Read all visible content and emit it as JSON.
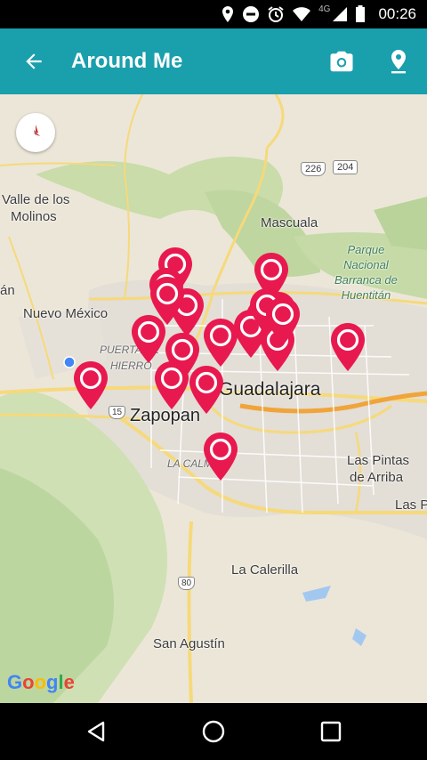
{
  "status_bar": {
    "time": "00:26",
    "network": "4G"
  },
  "app_bar": {
    "title": "Around Me",
    "back_icon": "arrow-back-icon",
    "camera_icon": "camera-icon",
    "location_icon": "place-icon"
  },
  "map": {
    "labels": {
      "valle": "Valle de los",
      "molinos": "Molinos",
      "mascuala": "Mascuala",
      "parque1": "Parque",
      "parque2": "Nacional",
      "parque3": "Barranca de",
      "parque4": "Huentitán",
      "nuevo_mexico": "Nuevo México",
      "puerta1": "PUERTA DE",
      "puerta2": "HIERRO",
      "guadalajara": "Guadalajara",
      "zapopan": "Zapopan",
      "la_calma": "LA CALMA",
      "las_pintas1": "Las Pintas",
      "las_pintas2": "de Arriba",
      "las_p": "Las P",
      "la_calerilla": "La Calerilla",
      "san_agustin": "San Agustín",
      "an": "án",
      "hw226": "226",
      "hw204": "204",
      "hw15": "15",
      "hw80": "80"
    },
    "marker_count": 20,
    "marker_color": "#e8194f",
    "attribution": "Google"
  },
  "colors": {
    "appbar": "#1a9fac",
    "marker": "#e8194f",
    "my_location": "#4285f4"
  },
  "nav_bar": {
    "back_icon": "nav-back-icon",
    "home_icon": "nav-home-icon",
    "recents_icon": "nav-recents-icon"
  }
}
